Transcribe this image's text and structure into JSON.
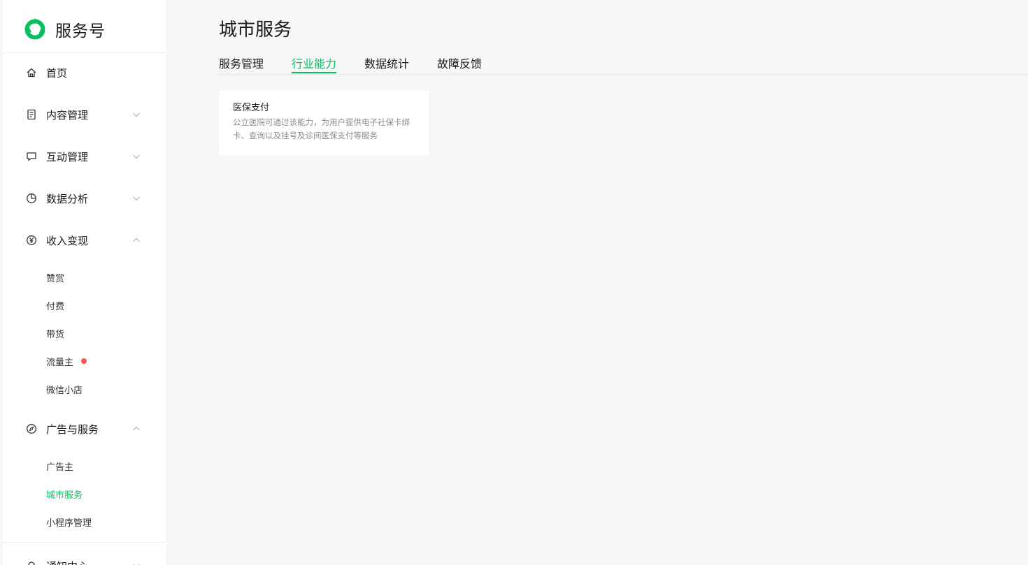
{
  "app": {
    "brand": "服务号",
    "logo_icon": "service-account-logo-icon",
    "accent_color": "#07c160"
  },
  "sidebar": {
    "items": [
      {
        "label": "首页",
        "icon": "home-icon"
      },
      {
        "label": "内容管理",
        "icon": "document-icon",
        "state": "collapsed"
      },
      {
        "label": "互动管理",
        "icon": "message-icon",
        "state": "collapsed"
      },
      {
        "label": "数据分析",
        "icon": "pie-chart-icon",
        "state": "collapsed"
      },
      {
        "label": "收入变现",
        "icon": "yuan-icon",
        "state": "expanded",
        "children": [
          {
            "label": "赞赏"
          },
          {
            "label": "付费"
          },
          {
            "label": "带货"
          },
          {
            "label": "流量主",
            "badge": "red-dot"
          },
          {
            "label": "微信小店"
          }
        ]
      },
      {
        "label": "广告与服务",
        "icon": "compass-icon",
        "state": "expanded",
        "children": [
          {
            "label": "广告主"
          },
          {
            "label": "城市服务",
            "active": true
          },
          {
            "label": "小程序管理"
          }
        ]
      },
      {
        "label": "通知中心",
        "icon": "bell-icon",
        "state": "collapsed"
      }
    ]
  },
  "main": {
    "title": "城市服务",
    "tabs": [
      {
        "label": "服务管理"
      },
      {
        "label": "行业能力",
        "active": true
      },
      {
        "label": "数据统计"
      },
      {
        "label": "故障反馈"
      }
    ],
    "cards": [
      {
        "title": "医保支付",
        "description": "公立医院可通过该能力，为用户提供电子社保卡绑卡、查询以及挂号及诊间医保支付等服务"
      }
    ]
  }
}
